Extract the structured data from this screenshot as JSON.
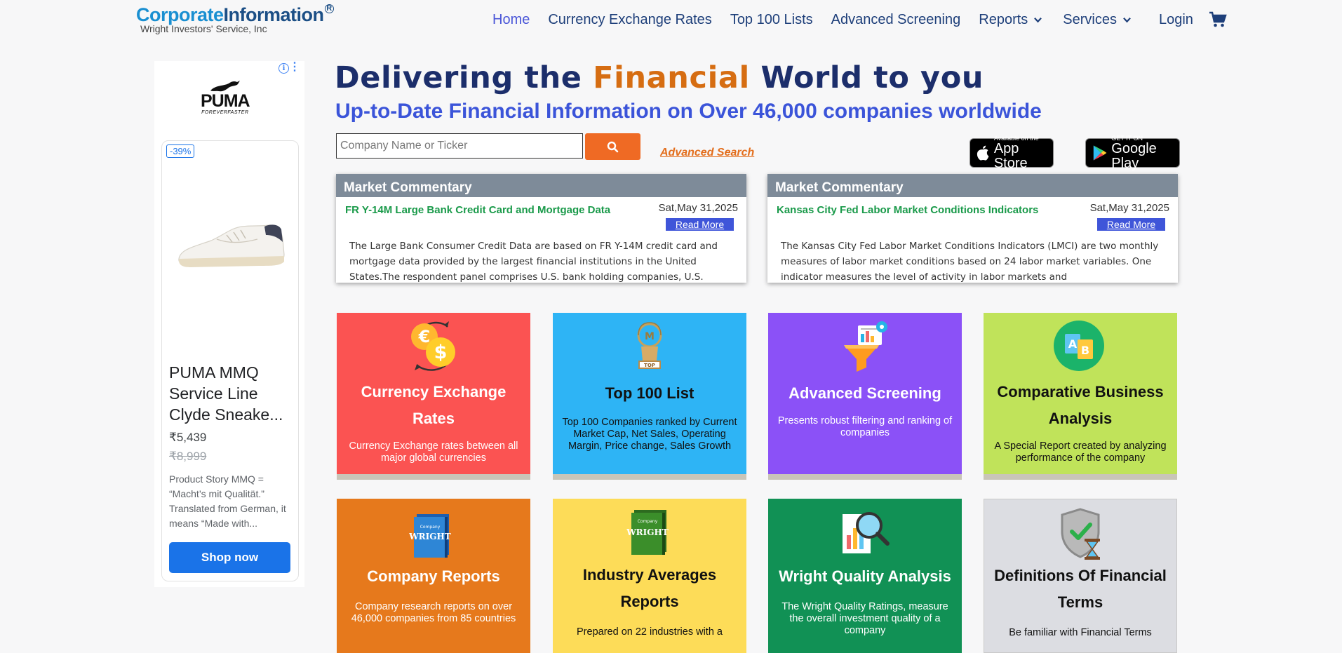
{
  "header": {
    "logo_part1": "Corporate",
    "logo_part2": "Information",
    "logo_reg": "R",
    "logo_sub": "Wright Investors' Service, Inc",
    "nav": [
      {
        "label": "Home"
      },
      {
        "label": "Currency Exchange Rates"
      },
      {
        "label": "Top 100 Lists"
      },
      {
        "label": "Advanced Screening"
      },
      {
        "label": "Reports"
      },
      {
        "label": "Services"
      },
      {
        "label": "Login"
      }
    ]
  },
  "ad": {
    "brand": "PUMA",
    "brand_tagline": "FOREVERFASTER",
    "info": "i",
    "discount": "-39%",
    "title": "PUMA MMQ Service Line Clyde Sneake...",
    "price": "₹5,439",
    "old_price": "₹8,999",
    "description": "Product Story MMQ = “Macht’s mit Qualität.” Translated from German, it means “Made with...",
    "cta": "Shop now"
  },
  "hero": {
    "title_part1": "Delivering the ",
    "title_accent": "Financial",
    "title_part2": " World to you",
    "subtitle": "Up-to-Date Financial Information on Over 46,000 companies worldwide"
  },
  "search": {
    "placeholder": "Company Name or Ticker",
    "advanced_link": "Advanced Search"
  },
  "stores": {
    "apple_small": "Available on the",
    "apple_big": "App Store",
    "google_small": "GET IT ON",
    "google_big": "Google Play"
  },
  "commentary": [
    {
      "header": "Market Commentary",
      "title": "FR Y-14M Large Bank Credit Card and Mortgage Data",
      "date": "Sat,May 31,2025",
      "more": "Read More",
      "body": "The Large Bank Consumer Credit Data are based on FR Y-14M credit card and mortgage data provided by the largest financial institutions in the United States.The respondent panel comprises U.S. bank holding companies, U.S."
    },
    {
      "header": "Market Commentary",
      "title": "Kansas City Fed Labor Market Conditions Indicators",
      "date": "Sat,May 31,2025",
      "more": "Read More",
      "body": "The Kansas City Fed Labor Market Conditions Indicators (LMCI) are two monthly measures of labor market conditions based on 24 labor market variables. One indicator measures the level of activity in labor markets and"
    }
  ],
  "tiles": [
    {
      "title": "Currency Exchange Rates",
      "desc": "Currency Exchange rates between all major global currencies",
      "color": "#fb5352"
    },
    {
      "title": "Top 100 List",
      "desc": "Top 100 Companies ranked by Current Market Cap, Net Sales, Operating Margin, Price change, Sales Growth",
      "color": "#2eb4f5",
      "icon_text": "TOP"
    },
    {
      "title": "Advanced Screening",
      "desc": "Presents robust filtering and ranking of companies",
      "color": "#8b51f7"
    },
    {
      "title": "Comparative Business Analysis",
      "desc": "A Special Report created by analyzing performance of the company",
      "color": "#c0e35a",
      "icon_text": "AB"
    },
    {
      "title": "Company Reports",
      "desc": "Company research reports on over 46,000 companies from 85 countries",
      "color": "#e6791c",
      "icon_text": "WRIGHT"
    },
    {
      "title": "Industry Averages Reports",
      "desc": "Prepared on 22 industries with a",
      "color": "#fddc58",
      "icon_text": "WRIGHT"
    },
    {
      "title": "Wright Quality Analysis",
      "desc": "The Wright Quality Ratings, measure the overall investment quality of a company",
      "color": "#119155"
    },
    {
      "title": "Definitions Of Financial Terms",
      "desc": "Be familiar with Financial Terms",
      "color": "#dcdde2"
    }
  ]
}
